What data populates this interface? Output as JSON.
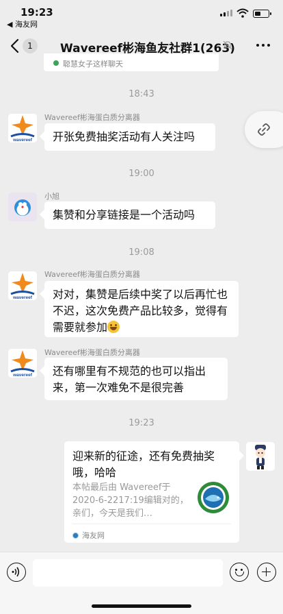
{
  "status_bar": {
    "time": "19:23",
    "back_app": "◀ 海友网"
  },
  "nav": {
    "back_count": "1",
    "title": "Wavereef彬海鱼友社群1(263)"
  },
  "top_card": {
    "source": "聪慧女子这样聊天"
  },
  "messages": [
    {
      "time": "18:43",
      "sender": "Wavereef彬海蛋白质分离器",
      "text": "开张免费抽奖活动有人关注吗"
    },
    {
      "time": "19:00",
      "sender": "小旭",
      "text": "集赞和分享链接是一个活动吗"
    },
    {
      "time": "19:08",
      "sender": "Wavereef彬海蛋白质分离器",
      "text": "对对，集赞是后续中奖了以后再忙也不迟，这次免费产品比较多，觉得有需要就参加"
    },
    {
      "sender": "Wavereef彬海蛋白质分离器",
      "text": "还有哪里有不规范的也可以指出来，第一次难免不是很完善"
    }
  ],
  "link_card": {
    "time": "19:23",
    "title": "迎来新的征途，还有免费抽奖哦，哈哈",
    "desc": "本帖最后由 Wavereef于2020-6-2217:19编辑对的，亲们，今天是我们…",
    "source": "海友网"
  },
  "icons": [
    "back-icon",
    "mute-icon",
    "more-icon",
    "link-icon",
    "voice-icon",
    "emoji-icon",
    "plus-icon"
  ],
  "colors": {
    "background": "#ededed",
    "bubble": "#ffffff",
    "brand_orange": "#f08a1c",
    "brand_blue": "#1d4fa0"
  }
}
